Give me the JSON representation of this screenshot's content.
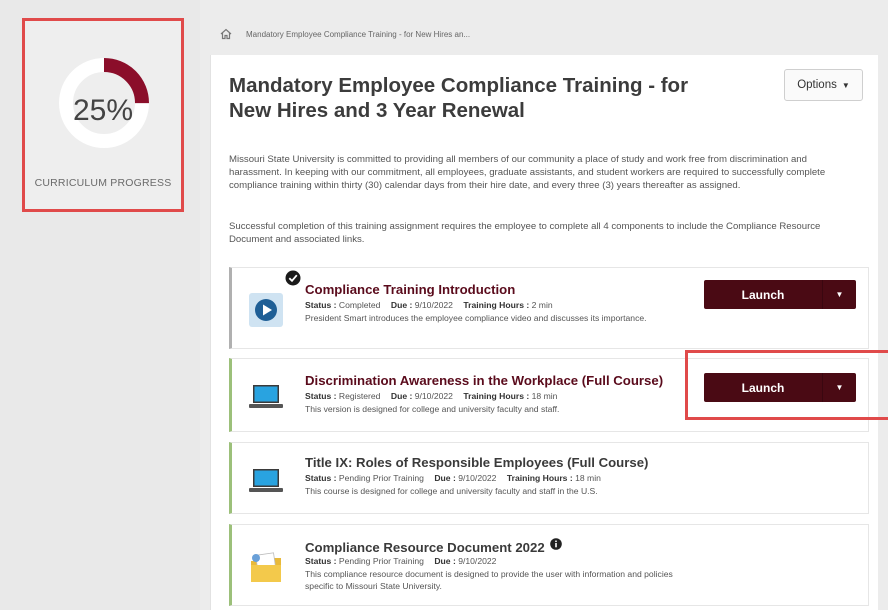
{
  "progress": {
    "percent_label": "25%",
    "value": 0.25,
    "caption": "CURRICULUM PROGRESS",
    "color": "#8b0e2a"
  },
  "breadcrumb": {
    "text": "Mandatory Employee Compliance Training - for New Hires an..."
  },
  "header": {
    "title": "Mandatory Employee Compliance Training - for New Hires and 3 Year Renewal",
    "options_label": "Options"
  },
  "intro": {
    "paragraph1": "Missouri State University is committed to providing all members of our community a place of study and work free from discrimination and harassment. In keeping with our commitment, all employees, graduate assistants, and student workers are required to successfully complete compliance training within thirty (30) calendar days from their hire date, and every three (3) years thereafter as assigned.",
    "paragraph2": "Successful completion of this training assignment requires the employee to complete all 4 components to include the Compliance Resource Document and associated links."
  },
  "labels": {
    "status": "Status :",
    "due": "Due :",
    "hours": "Training Hours :",
    "launch": "Launch"
  },
  "items": [
    {
      "title": "Compliance Training Introduction",
      "status": "Completed",
      "due": "9/10/2022",
      "hours": "2 min",
      "description": "President Smart introduces the employee compliance video and discusses its importance.",
      "icon": "play-video-icon"
    },
    {
      "title": "Discrimination Awareness in the Workplace (Full Course)",
      "status": "Registered",
      "due": "9/10/2022",
      "hours": "18 min",
      "description": "This version is designed for college and university faculty and staff.",
      "icon": "laptop-icon"
    },
    {
      "title": "Title IX: Roles of Responsible Employees (Full Course)",
      "status": "Pending Prior Training",
      "due": "9/10/2022",
      "hours": "18 min",
      "description": "This course is designed for college and university faculty and staff in the U.S.",
      "icon": "laptop-icon"
    },
    {
      "title": "Compliance Resource Document 2022",
      "status": "Pending Prior Training",
      "due": "9/10/2022",
      "description": "This compliance resource document is designed to provide the user with information and policies specific to Missouri State University.",
      "icon": "document-folder-icon"
    }
  ],
  "colors": {
    "maroon_button": "#4a0a14",
    "title_maroon": "#5a0b1c",
    "highlight_red": "#e04a4a",
    "card_accent_green": "#9cc07a"
  }
}
